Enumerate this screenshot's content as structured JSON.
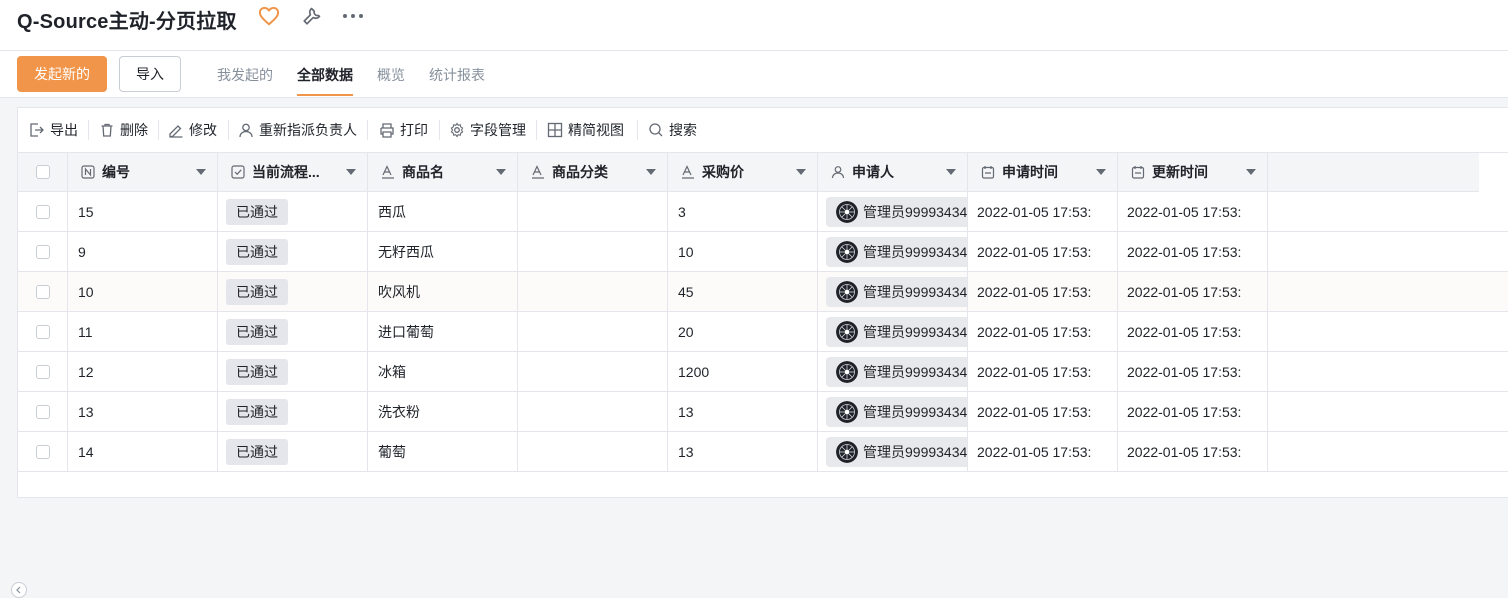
{
  "app": {
    "title": "Q-Source主动-分页拉取",
    "colors": {
      "accent": "#f0954a",
      "heart": "#f0954a",
      "pill_bg": "#e5e6eb"
    },
    "icons": [
      "heart-icon",
      "wrench-icon",
      "more-icon"
    ]
  },
  "actions": {
    "create_label": "发起新的",
    "import_label": "导入"
  },
  "tabs": [
    {
      "label": "我发起的",
      "active": false
    },
    {
      "label": "全部数据",
      "active": true
    },
    {
      "label": "概览",
      "active": false
    },
    {
      "label": "统计报表",
      "active": false
    }
  ],
  "toolbar": [
    {
      "label": "导出",
      "icon": "export-icon"
    },
    {
      "label": "删除",
      "icon": "trash-icon"
    },
    {
      "label": "修改",
      "icon": "edit-icon"
    },
    {
      "label": "重新指派负责人",
      "icon": "user-icon"
    },
    {
      "label": "打印",
      "icon": "printer-icon"
    },
    {
      "label": "字段管理",
      "icon": "settings-icon"
    },
    {
      "label": "精简视图",
      "icon": "grid-icon"
    },
    {
      "label": "搜索",
      "icon": "search-icon"
    }
  ],
  "table": {
    "columns": [
      {
        "label": "编号",
        "icon": "number-field-icon"
      },
      {
        "label": "当前流程...",
        "icon": "status-field-icon"
      },
      {
        "label": "商品名",
        "icon": "text-field-icon"
      },
      {
        "label": "商品分类",
        "icon": "text-field-icon"
      },
      {
        "label": "采购价",
        "icon": "text-field-icon"
      },
      {
        "label": "申请人",
        "icon": "person-field-icon"
      },
      {
        "label": "申请时间",
        "icon": "date-field-icon"
      },
      {
        "label": "更新时间",
        "icon": "date-field-icon"
      }
    ],
    "rows": [
      {
        "id": "15",
        "status": "已通过",
        "name": "西瓜",
        "category": "",
        "price": "3",
        "applicant": "管理员99993434",
        "created": "2022-01-05 17:53:",
        "updated": "2022-01-05 17:53:"
      },
      {
        "id": "9",
        "status": "已通过",
        "name": "无籽西瓜",
        "category": "",
        "price": "10",
        "applicant": "管理员99993434",
        "created": "2022-01-05 17:53:",
        "updated": "2022-01-05 17:53:"
      },
      {
        "id": "10",
        "status": "已通过",
        "name": "吹风机",
        "category": "",
        "price": "45",
        "applicant": "管理员99993434",
        "created": "2022-01-05 17:53:",
        "updated": "2022-01-05 17:53:"
      },
      {
        "id": "11",
        "status": "已通过",
        "name": "进口葡萄",
        "category": "",
        "price": "20",
        "applicant": "管理员99993434",
        "created": "2022-01-05 17:53:",
        "updated": "2022-01-05 17:53:"
      },
      {
        "id": "12",
        "status": "已通过",
        "name": "冰箱",
        "category": "",
        "price": "1200",
        "applicant": "管理员99993434",
        "created": "2022-01-05 17:53:",
        "updated": "2022-01-05 17:53:"
      },
      {
        "id": "13",
        "status": "已通过",
        "name": "洗衣粉",
        "category": "",
        "price": "13",
        "applicant": "管理员99993434",
        "created": "2022-01-05 17:53:",
        "updated": "2022-01-05 17:53:"
      },
      {
        "id": "14",
        "status": "已通过",
        "name": "葡萄",
        "category": "",
        "price": "13",
        "applicant": "管理员99993434",
        "created": "2022-01-05 17:53:",
        "updated": "2022-01-05 17:53:"
      }
    ]
  }
}
